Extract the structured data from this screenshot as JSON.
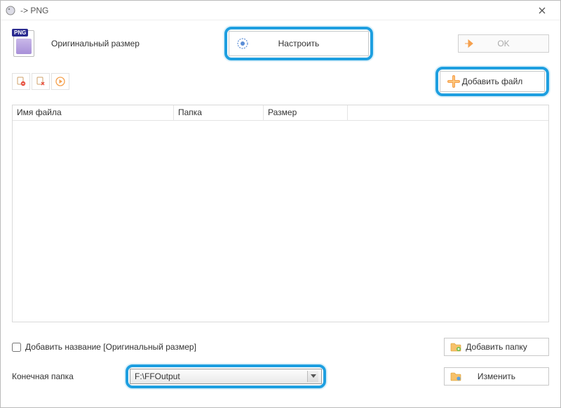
{
  "titlebar": {
    "title": " -> PNG"
  },
  "top": {
    "original_size_label": "Оригинальный размер",
    "settings_button_label": "Настроить",
    "ok_button_label": "OK"
  },
  "toolbar": {
    "add_file_label": "Добавить файл"
  },
  "table": {
    "columns": {
      "name": "Имя файла",
      "folder": "Папка",
      "size": "Размер"
    },
    "rows": []
  },
  "bottom": {
    "add_title_checkbox_label": "Добавить название [Оригинальный размер]",
    "add_title_checked": false,
    "add_folder_label": "Добавить папку",
    "dest_label": "Конечная папка",
    "dest_value": "F:\\FFOutput",
    "change_label": "Изменить"
  },
  "colors": {
    "highlight": "#1e9fe0",
    "accent_orange": "#f5a04d"
  }
}
